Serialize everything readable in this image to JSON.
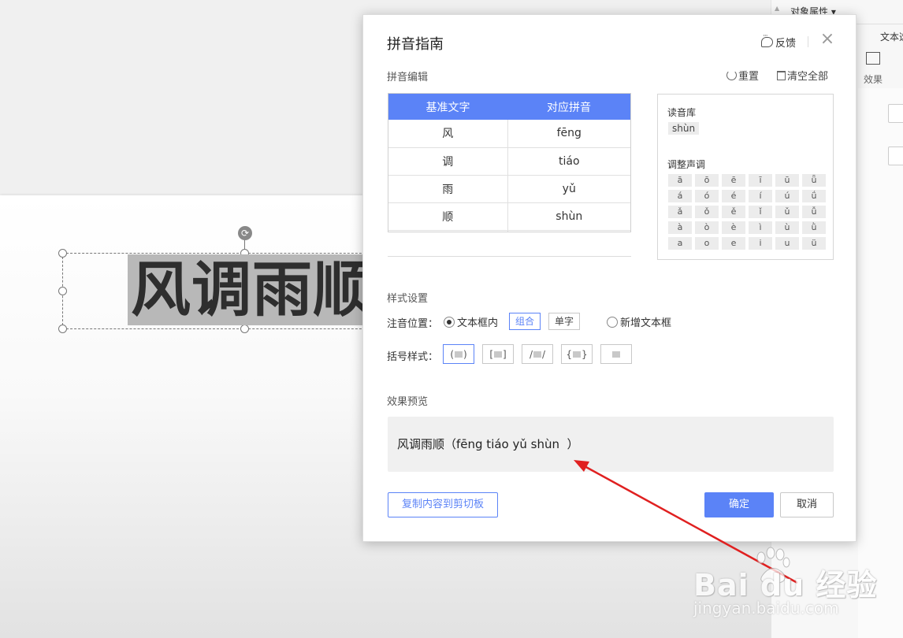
{
  "app": {
    "panel_title": "对象属性 ▾",
    "panel_tab": "文本选",
    "effect_label": "效果",
    "slide_text": "风调雨顺"
  },
  "dialog": {
    "title": "拼音指南",
    "feedback_label": "反馈",
    "close_glyph": "×",
    "edit_section_label": "拼音编辑",
    "reset_label": "重置",
    "clear_all_label": "清空全部",
    "table": {
      "headers": [
        "基准文字",
        "对应拼音"
      ],
      "rows": [
        [
          "风",
          "fēng"
        ],
        [
          "调",
          "tiáo"
        ],
        [
          "雨",
          "yǔ"
        ],
        [
          "顺",
          "shùn"
        ]
      ]
    },
    "reading_library_title": "读音库",
    "reading_option": "shùn",
    "tone_title": "调整声调",
    "tones": [
      [
        "ā",
        "ō",
        "ē",
        "ī",
        "ū",
        "ǖ"
      ],
      [
        "á",
        "ó",
        "é",
        "í",
        "ú",
        "ǘ"
      ],
      [
        "ǎ",
        "ǒ",
        "ě",
        "ǐ",
        "ǔ",
        "ǚ"
      ],
      [
        "à",
        "ò",
        "è",
        "ì",
        "ù",
        "ǜ"
      ],
      [
        "a",
        "o",
        "e",
        "i",
        "u",
        "ü"
      ]
    ],
    "style_section_label": "样式设置",
    "position_label": "注音位置：",
    "position_inbox_label": "文本框内",
    "combo_label": "组合",
    "single_label": "单字",
    "position_newbox_label": "新增文本框",
    "bracket_label": "括号样式：",
    "bracket_styles": [
      {
        "left": "(",
        "right": ")"
      },
      {
        "left": "[",
        "right": "]"
      },
      {
        "left": "/",
        "right": "/"
      },
      {
        "left": "{",
        "right": "}"
      },
      {
        "left": "",
        "right": ""
      }
    ],
    "preview_section_label": "效果预览",
    "preview_text": "风调雨顺（fēng tiáo yǔ shùn  ）",
    "copy_label": "复制内容到剪切板",
    "ok_label": "确定",
    "cancel_label": "取消"
  },
  "watermark": {
    "brand": "Bai du 经验",
    "url": "jingyan.baidu.com"
  },
  "colors": {
    "accent": "#5b83f7",
    "arrow": "#e02020"
  }
}
